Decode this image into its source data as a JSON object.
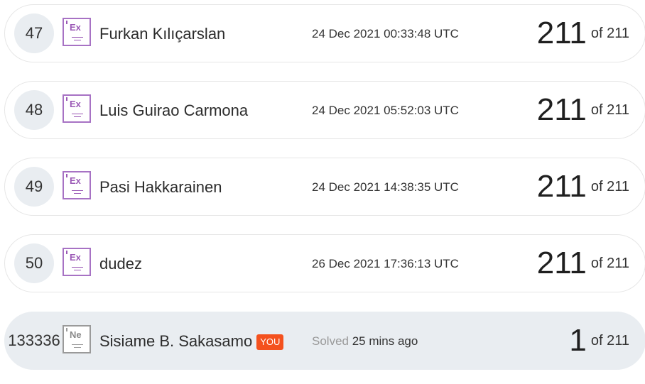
{
  "leaderboard": {
    "rows": [
      {
        "rank": "47",
        "badge": "Ex",
        "name": "Furkan Kılıçarslan",
        "time": "24 Dec 2021 00:33:48 UTC",
        "score": "211",
        "of": "of 211"
      },
      {
        "rank": "48",
        "badge": "Ex",
        "name": "Luis Guirao Carmona",
        "time": "24 Dec 2021 05:52:03 UTC",
        "score": "211",
        "of": "of 211"
      },
      {
        "rank": "49",
        "badge": "Ex",
        "name": "Pasi Hakkarainen",
        "time": "24 Dec 2021 14:38:35 UTC",
        "score": "211",
        "of": "of 211"
      },
      {
        "rank": "50",
        "badge": "Ex",
        "name": "dudez",
        "time": "26 Dec 2021 17:36:13 UTC",
        "score": "211",
        "of": "of 211"
      }
    ],
    "current_user": {
      "rank": "133336",
      "badge": "Ne",
      "name": "Sisiame B. Sakasamo",
      "you_label": "YOU",
      "solved_label": "Solved",
      "solved_time": "25 mins ago",
      "score": "1",
      "of": "of 211"
    }
  },
  "colors": {
    "expert_badge": "#9b59b6",
    "novice_badge": "#9a9a9a",
    "you_badge": "#f4511e",
    "rank_circle": "#e9edf1"
  }
}
